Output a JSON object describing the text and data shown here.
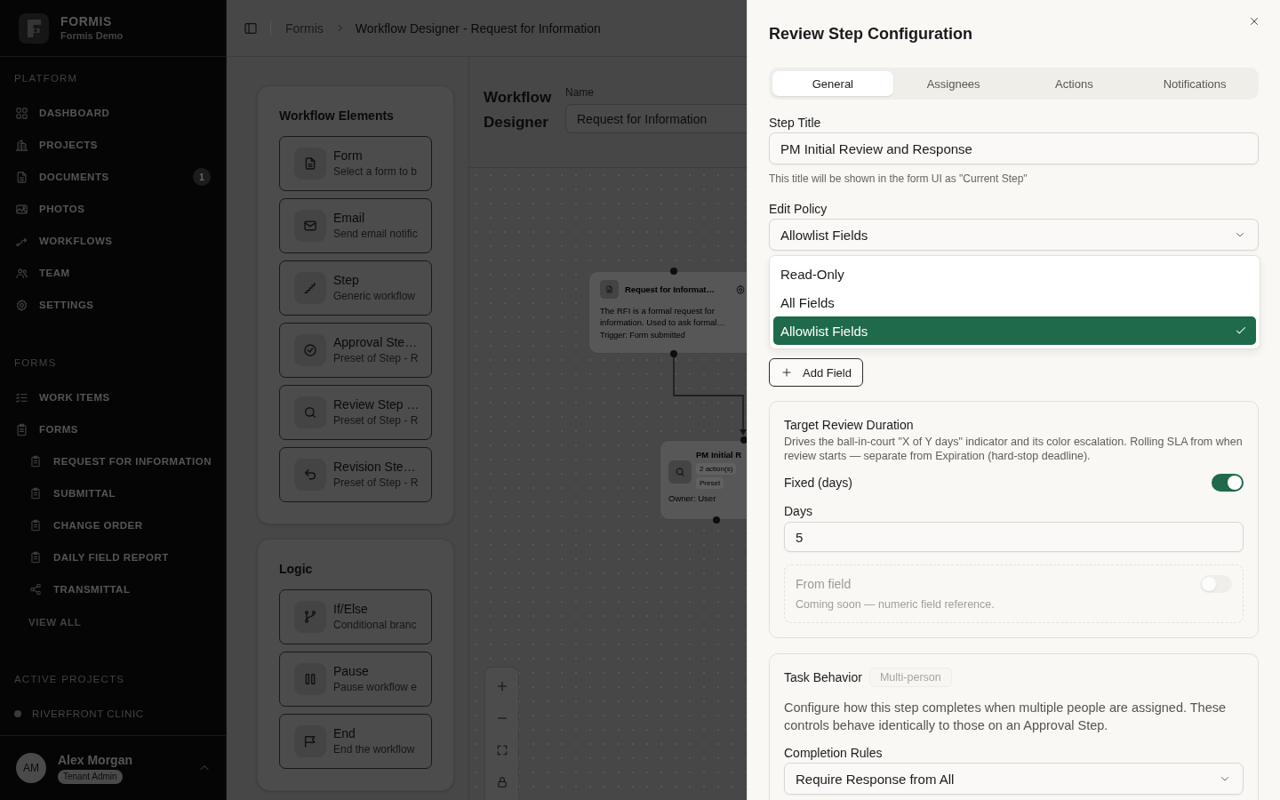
{
  "sidebar": {
    "brand": {
      "name": "FORMIS",
      "subtitle": "Formis Demo"
    },
    "platform": {
      "title": "PLATFORM",
      "items": [
        {
          "label": "DASHBOARD"
        },
        {
          "label": "PROJECTS"
        },
        {
          "label": "DOCUMENTS",
          "badge": "1"
        },
        {
          "label": "PHOTOS"
        },
        {
          "label": "WORKFLOWS"
        },
        {
          "label": "TEAM"
        },
        {
          "label": "SETTINGS"
        }
      ]
    },
    "forms": {
      "title": "FORMS",
      "items": [
        {
          "label": "WORK ITEMS"
        },
        {
          "label": "FORMS",
          "children": [
            {
              "label": "REQUEST FOR INFORMATION"
            },
            {
              "label": "SUBMITTAL"
            },
            {
              "label": "CHANGE ORDER"
            },
            {
              "label": "DAILY FIELD REPORT"
            },
            {
              "label": "TRANSMITTAL"
            }
          ]
        }
      ],
      "link": "VIEW ALL"
    },
    "active_projects": {
      "title": "ACTIVE PROJECTS",
      "items": [
        {
          "label": "RIVERFRONT CLINIC"
        }
      ]
    },
    "user": {
      "initials": "AM",
      "name": "Alex Morgan",
      "role": "Tenant Admin"
    }
  },
  "header": {
    "breadcrumb": [
      "Formis",
      "Workflow Designer - Request for Information"
    ]
  },
  "elements_panel": {
    "title": "Workflow Elements",
    "items": [
      {
        "title": "Form",
        "description": "Select a form to b"
      },
      {
        "title": "Email",
        "description": "Send email notific"
      },
      {
        "title": "Step",
        "description": "Generic workflow"
      },
      {
        "title": "Approval Ste…",
        "description": "Preset of Step - R"
      },
      {
        "title": "Review Step …",
        "description": "Preset of Step - R"
      },
      {
        "title": "Revision Ste…",
        "description": "Preset of Step - R"
      }
    ]
  },
  "logic_panel": {
    "title": "Logic",
    "items": [
      {
        "title": "If/Else",
        "description": "Conditional branc"
      },
      {
        "title": "Pause",
        "description": "Pause workflow e"
      },
      {
        "title": "End",
        "description": "End the workflow"
      }
    ]
  },
  "designer": {
    "title": "Workflow Designer",
    "name_label": "Name",
    "name_value": "Request for Information",
    "nodes": [
      {
        "kind": "trigger",
        "title": "Request for Informat…",
        "description": "The RFI is a formal request for information. Used to ask formal…",
        "footer": "Trigger: Form submitted"
      },
      {
        "kind": "step",
        "title": "PM Initial R",
        "badges": [
          "2 action(s)",
          "Preset"
        ],
        "footer": "Owner: User"
      }
    ]
  },
  "panel": {
    "title": "Review Step Configuration",
    "tabs": [
      {
        "label": "General",
        "selected": true
      },
      {
        "label": "Assignees",
        "selected": false
      },
      {
        "label": "Actions",
        "selected": false
      },
      {
        "label": "Notifications",
        "selected": false
      }
    ],
    "step_title": {
      "label": "Step Title",
      "value": "PM Initial Review and Response",
      "hint": "This title will be shown in the form UI as \"Current Step\""
    },
    "edit_policy": {
      "label": "Edit Policy",
      "value": "Allowlist Fields",
      "expanded": true,
      "options": [
        {
          "label": "Read-Only",
          "selected": false
        },
        {
          "label": "All Fields",
          "selected": false
        },
        {
          "label": "Allowlist Fields",
          "selected": true
        }
      ]
    },
    "add_field_button": "Add Field",
    "target_review_duration": {
      "title": "Target Review Duration",
      "description": "Drives the ball-in-court \"X of Y days\" indicator and its color escalation. Rolling SLA from when review starts — separate from Expiration (hard-stop deadline).",
      "fixed": {
        "label": "Fixed (days)",
        "on": true,
        "field_label": "Days",
        "value": "5"
      },
      "from_field": {
        "label": "From field",
        "note": "Coming soon — numeric field reference.",
        "on": false,
        "disabled": true
      }
    },
    "task_behavior": {
      "title": "Task Behavior",
      "badge": "Multi-person",
      "description": "Configure how this step completes when multiple people are assigned. These controls behave identically to those on an Approval Step.",
      "completion_rules": {
        "label": "Completion Rules",
        "value": "Require Response from All"
      }
    }
  }
}
